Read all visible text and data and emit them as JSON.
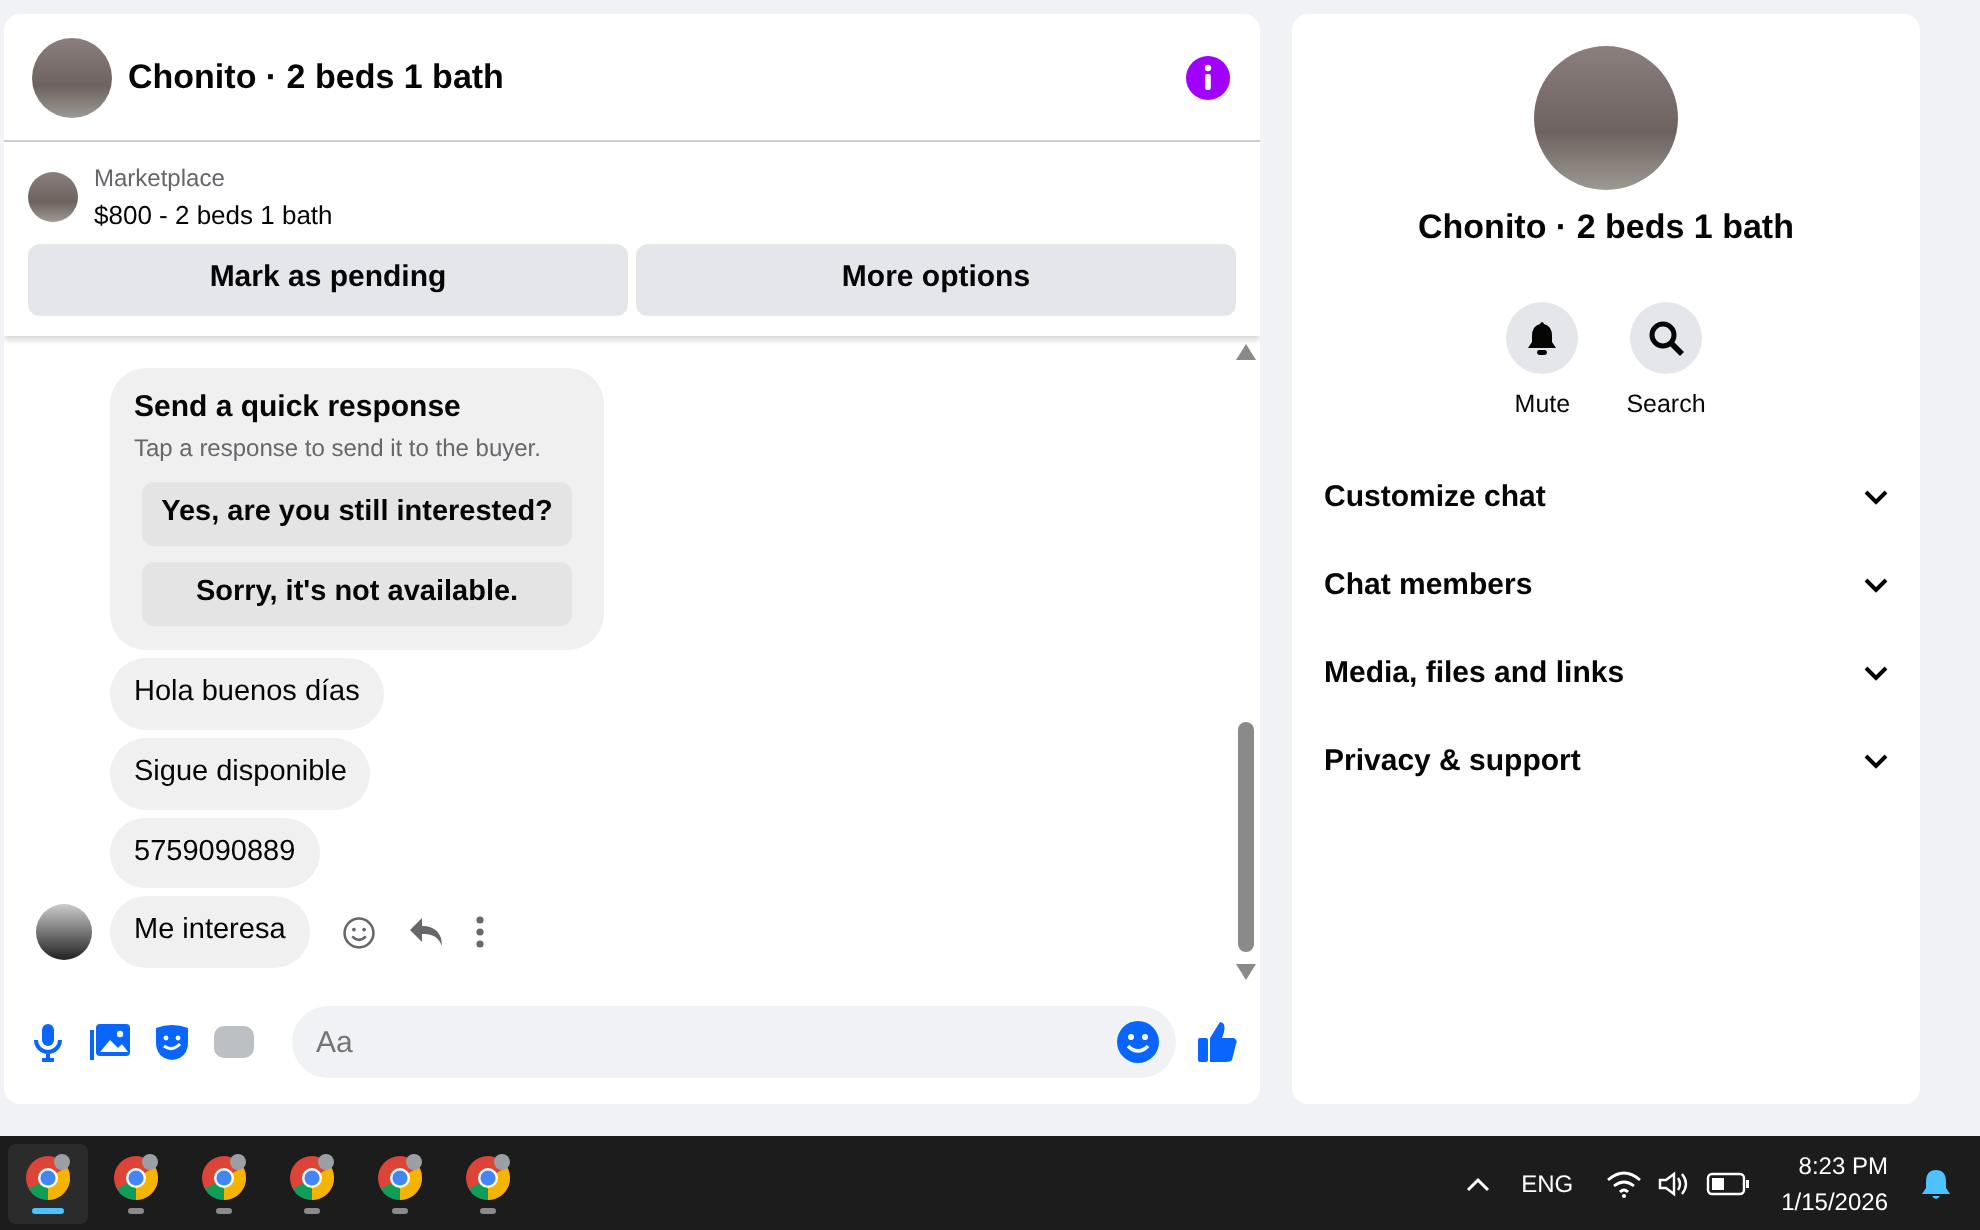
{
  "chat": {
    "title": "Chonito · 2 beds 1 bath",
    "listing": {
      "source": "Marketplace",
      "summary": "$800 - 2 beds 1 bath",
      "actions": [
        "Mark as pending",
        "More options"
      ]
    },
    "messages": [
      {
        "kind": "quick_response",
        "title": "Send a quick response",
        "subtitle": "Tap a response to send it to the buyer.",
        "options": [
          "Yes, are you still interested?",
          "Sorry, it's not available."
        ]
      },
      {
        "kind": "text",
        "text": "Hola buenos días"
      },
      {
        "kind": "text",
        "text": "Sigue disponible"
      },
      {
        "kind": "text",
        "text": "5759090889"
      },
      {
        "kind": "latest",
        "text": "Me interesa"
      }
    ],
    "composer": {
      "placeholder": "Aa"
    }
  },
  "details": {
    "title": "Chonito · 2 beds 1 bath",
    "actions": [
      {
        "kind": "bell",
        "label": "Mute"
      },
      {
        "kind": "search",
        "label": "Search"
      }
    ],
    "sections": [
      {
        "label": "Customize chat",
        "expanded": false
      },
      {
        "label": "Chat members",
        "expanded": false
      },
      {
        "label": "Media, files and links",
        "expanded": false
      },
      {
        "label": "Privacy & support",
        "expanded": false
      }
    ]
  },
  "taskbar": {
    "apps": [
      {
        "selected": true
      },
      {
        "selected": false
      },
      {
        "selected": false
      },
      {
        "selected": false
      },
      {
        "selected": false
      },
      {
        "selected": false
      }
    ],
    "language": "ENG",
    "time": "8:23 PM",
    "date": "1/15/2026"
  }
}
